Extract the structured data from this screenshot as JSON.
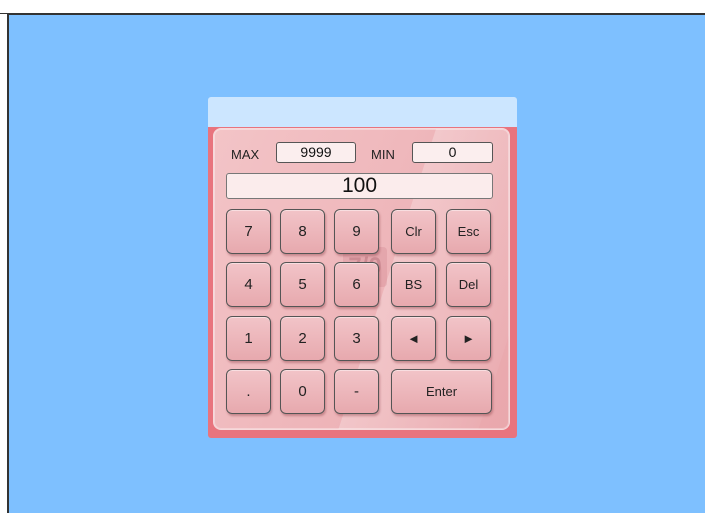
{
  "keypad": {
    "max_label": "MAX",
    "max_value": "9999",
    "min_label": "MIN",
    "min_value": "0",
    "display_value": "100",
    "watermark_text": "7/0",
    "keys": {
      "k7": "7",
      "k8": "8",
      "k9": "9",
      "clr": "Clr",
      "esc": "Esc",
      "k4": "4",
      "k5": "5",
      "k6": "6",
      "bs": "BS",
      "del": "Del",
      "k1": "1",
      "k2": "2",
      "k3": "3",
      "left": "◄",
      "right": "►",
      "dot": ".",
      "k0": "0",
      "minus": "-",
      "enter": "Enter"
    }
  },
  "colors": {
    "desktop": "#7ec0ff",
    "titlebar": "#cce6ff",
    "frame": "#e8747e",
    "pad": "#efb8bc"
  }
}
